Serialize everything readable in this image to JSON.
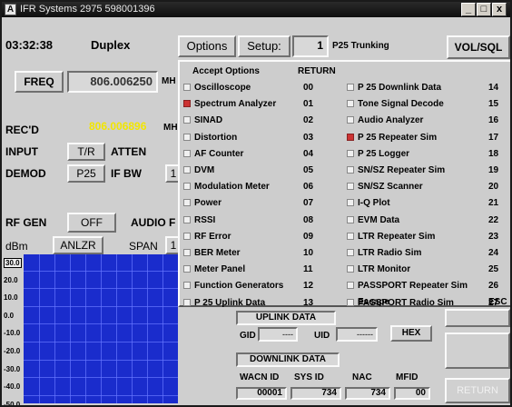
{
  "window": {
    "title": "IFR Systems 2975 598001396",
    "min": "_",
    "max": "□",
    "close": "x"
  },
  "top": {
    "time": "03:32:38",
    "mode": "Duplex",
    "options": "Options",
    "setup": "Setup:",
    "setup_value": "1",
    "setup_name": "P25 Trunking",
    "volsql": "VOL/SQL"
  },
  "left": {
    "freq_button": "FREQ",
    "freq_value": "806.006250",
    "freq_unit": "MH",
    "recd_label": "REC'D",
    "recd_value": "806.006896",
    "recd_unit": "MH",
    "input_label": "INPUT",
    "input_value": "T/R",
    "atten_label": "ATTEN",
    "demod_label": "DEMOD",
    "demod_value": "P25",
    "ifbw_label": "IF BW",
    "ifbw_value": "1",
    "rfgen_label": "RF GEN",
    "rfgen_value": "OFF",
    "audio_label": "AUDIO F",
    "dbm_label": "dBm",
    "anlzr_label": "ANLZR",
    "span_label": "SPAN",
    "span_value": "1"
  },
  "plot": {
    "yticks": [
      "30.0",
      "20.0",
      "10.0",
      "0.0",
      "-10.0",
      "-20.0",
      "-30.0",
      "-40.0",
      "-50.0"
    ]
  },
  "menu": {
    "header": {
      "left": "Accept Options",
      "mid": "RETURN"
    },
    "left_items": [
      {
        "label": "Oscilloscope",
        "num": "00",
        "checked": false
      },
      {
        "label": "Spectrum Analyzer",
        "num": "01",
        "checked": true
      },
      {
        "label": "SINAD",
        "num": "02",
        "checked": false
      },
      {
        "label": "Distortion",
        "num": "03",
        "checked": false
      },
      {
        "label": "AF Counter",
        "num": "04",
        "checked": false
      },
      {
        "label": "DVM",
        "num": "05",
        "checked": false
      },
      {
        "label": "Modulation Meter",
        "num": "06",
        "checked": false
      },
      {
        "label": "Power",
        "num": "07",
        "checked": false
      },
      {
        "label": "RSSI",
        "num": "08",
        "checked": false
      },
      {
        "label": "RF Error",
        "num": "09",
        "checked": false
      },
      {
        "label": "BER Meter",
        "num": "10",
        "checked": false
      },
      {
        "label": "Meter Panel",
        "num": "11",
        "checked": false
      },
      {
        "label": "Function Generators",
        "num": "12",
        "checked": false
      },
      {
        "label": "P 25 Uplink Data",
        "num": "13",
        "checked": false
      }
    ],
    "right_items": [
      {
        "label": "P 25 Downlink Data",
        "num": "14",
        "checked": false
      },
      {
        "label": "Tone Signal Decode",
        "num": "15",
        "checked": false
      },
      {
        "label": "Audio Analyzer",
        "num": "16",
        "checked": false
      },
      {
        "label": "P 25 Repeater Sim",
        "num": "17",
        "checked": true
      },
      {
        "label": "P 25 Logger",
        "num": "18",
        "checked": false
      },
      {
        "label": "SN/SZ Repeater Sim",
        "num": "19",
        "checked": false
      },
      {
        "label": "SN/SZ Scanner",
        "num": "20",
        "checked": false
      },
      {
        "label": "I-Q Plot",
        "num": "21",
        "checked": false
      },
      {
        "label": "EVM Data",
        "num": "22",
        "checked": false
      },
      {
        "label": "LTR Repeater Sim",
        "num": "23",
        "checked": false
      },
      {
        "label": "LTR Radio Sim",
        "num": "24",
        "checked": false
      },
      {
        "label": "LTR Monitor",
        "num": "25",
        "checked": false
      },
      {
        "label": "PASSPORT Repeater Sim",
        "num": "26",
        "checked": false
      },
      {
        "label": "PASSPORT Radio Sim",
        "num": "27",
        "checked": false
      }
    ],
    "escape": "Escape",
    "esc": "ESC"
  },
  "uplink": {
    "title": "UPLINK DATA",
    "gid_label": "GID",
    "gid_value": "----",
    "uid_label": "UID",
    "uid_value": "------",
    "hex": "HEX"
  },
  "downlink": {
    "title": "DOWNLINK DATA",
    "wacn_label": "WACN ID",
    "sysid_label": "SYS ID",
    "nac_label": "NAC",
    "mfid_label": "MFID",
    "wacn_value": "00001",
    "sysid_value": "734",
    "nac_value": "734",
    "mfid_value": "00"
  },
  "right_buttons": {
    "return_label": "RETURN"
  },
  "colors": {
    "recd_value": "#f2e600",
    "plot_bg": "#1a2ccc",
    "check_on": "#cc3333"
  }
}
